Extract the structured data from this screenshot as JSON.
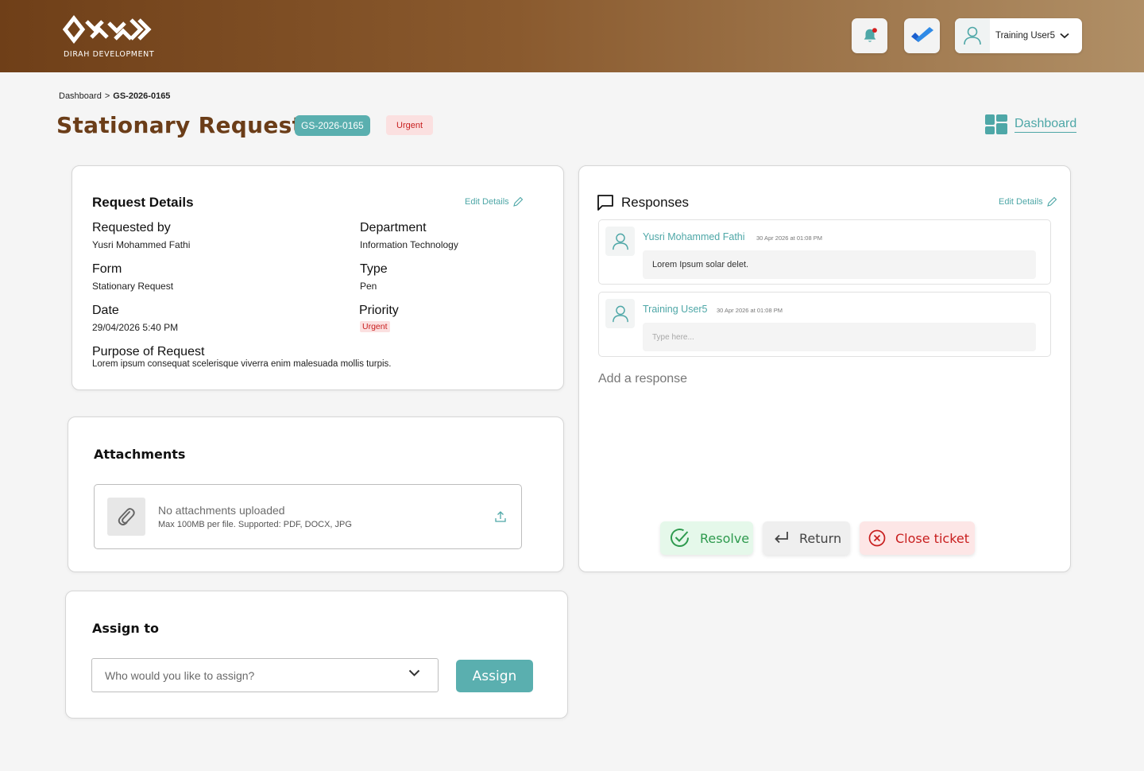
{
  "header": {
    "logo_text": "DIRAH DEVELOPMENT",
    "user_name": "Training User5",
    "icons": [
      "notification-bell-icon",
      "tasks-check-icon",
      "user-icon",
      "chevron-down-icon"
    ]
  },
  "breadcrumb": {
    "root": "Dashboard",
    "separator": ">",
    "current": "GS-2026-0165"
  },
  "page": {
    "title": "Stationary Request",
    "ticket_id": "GS-2026-0165",
    "priority": "Urgent",
    "dashboard_link": "Dashboard"
  },
  "request_details": {
    "title": "Request Details",
    "edit_label": "Edit Details",
    "requested_by_label": "Requested by",
    "requested_by": "Yusri Mohammed Fathi",
    "department_label": "Department",
    "department": "Information Technology",
    "form_label": "Form",
    "form": "Stationary Request",
    "type_label": "Type",
    "type": "Pen",
    "date_label": "Date",
    "date": "29/04/2026 5:40 PM",
    "priority_label": "Priority",
    "priority": "Urgent",
    "purpose_label": "Purpose of Request",
    "purpose": "Lorem ipsum consequat scelerisque viverra enim malesuada mollis turpis."
  },
  "attachments": {
    "title": "Attachments",
    "empty_text": "No attachments uploaded",
    "hint": "Max 100MB per file. Supported: PDF, DOCX, JPG"
  },
  "assign": {
    "title": "Assign to",
    "placeholder": "Who would you like to assign?",
    "button": "Assign"
  },
  "responses": {
    "title": "Responses",
    "edit_label": "Edit Details",
    "items": [
      {
        "name": "Yusri Mohammed Fathi",
        "time": "30 Apr 2026 at 01:08 PM",
        "message": "Lorem Ipsum solar delet."
      },
      {
        "name": "Training User5",
        "time": "30 Apr 2026 at 01:08 PM",
        "placeholder": "Type here..."
      }
    ],
    "add_response": "Add a response",
    "actions": {
      "resolve": "Resolve",
      "return": "Return",
      "close": "Close ticket"
    }
  },
  "colors": {
    "brand_brown": "#6b3d18",
    "accent_teal": "#5aafaf",
    "urgent_red": "#c81e1e",
    "urgent_bg": "#fbe0e0",
    "resolve_green": "#2e9a4e"
  }
}
